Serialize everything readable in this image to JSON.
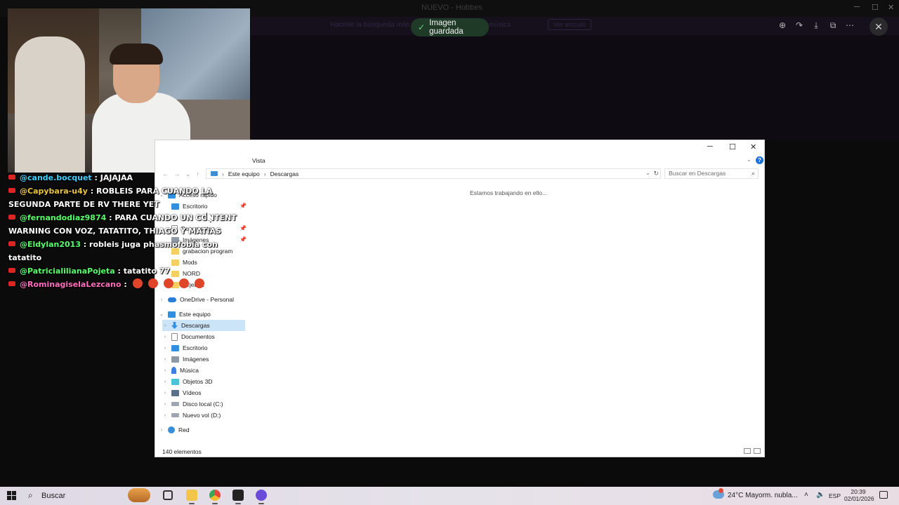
{
  "background": {
    "title": "NUEVO - Hobbes",
    "banner_text": "Hacerle la búsqueda más fácil a los usuarios de la música",
    "banner_button": "Ver artículo"
  },
  "toast": {
    "text": "Imagen guardada"
  },
  "viewer_toolbar": {
    "icons": [
      "zoom-in-icon",
      "share-icon",
      "download-icon",
      "open-external-icon",
      "more-icon",
      "close-icon"
    ]
  },
  "chat": {
    "messages": [
      {
        "user": "@cande.bocquet",
        "text": " : JAJAJAA",
        "user_color": "#3fd0ff"
      },
      {
        "user": "@Capybara-u4y",
        "text": " : ROBLEIS PARA CUANDO LA SEGUNDA PARTE DE RV THERE YET",
        "user_color": "#e9c343"
      },
      {
        "user": "@fernandodiaz9874",
        "text": " : PARA CUANDO UN CONTENT WARNING CON VOZ, TATATITO, THIAGO Y MATIAS",
        "user_color": "#58ff6a"
      },
      {
        "user": "@Eldylan2013",
        "text": " : robleis juga phasmofobia con tatatito",
        "user_color": "#58ff6a"
      },
      {
        "user": "@PatricialilianaPojeta",
        "text": " : tatatito 77",
        "user_color": "#58ff6a"
      },
      {
        "user": "@RominagiselaLezcano",
        "text": " :",
        "user_color": "#ff6fbd"
      }
    ]
  },
  "explorer": {
    "ribbon_tab": "Vista",
    "address": {
      "root": "Este equipo",
      "current": "Descargas"
    },
    "search_placeholder": "Buscar en Descargas",
    "loading_text": "Estamos trabajando en ello...",
    "status": "140 elementos",
    "sidebar": {
      "quick_access": "Acceso rápido",
      "quick_items": [
        "Escritorio",
        "Documentos",
        "Imágenes",
        "grabacion program",
        "Mods",
        "NORD",
        "tarjeta 2"
      ],
      "onedrive": "OneDrive - Personal",
      "this_pc": "Este equipo",
      "pc_items": [
        "Descargas",
        "Documentos",
        "Escritorio",
        "Imágenes",
        "Música",
        "Objetos 3D",
        "Vídeos",
        "Disco local (C:)",
        "Nuevo vol (D:)"
      ],
      "network": "Red"
    }
  },
  "taskbar": {
    "search": "Buscar",
    "weather": "24°C  Mayorm. nubla...",
    "lang": "ESP",
    "time": "20:39",
    "date": "02/01/2026"
  }
}
